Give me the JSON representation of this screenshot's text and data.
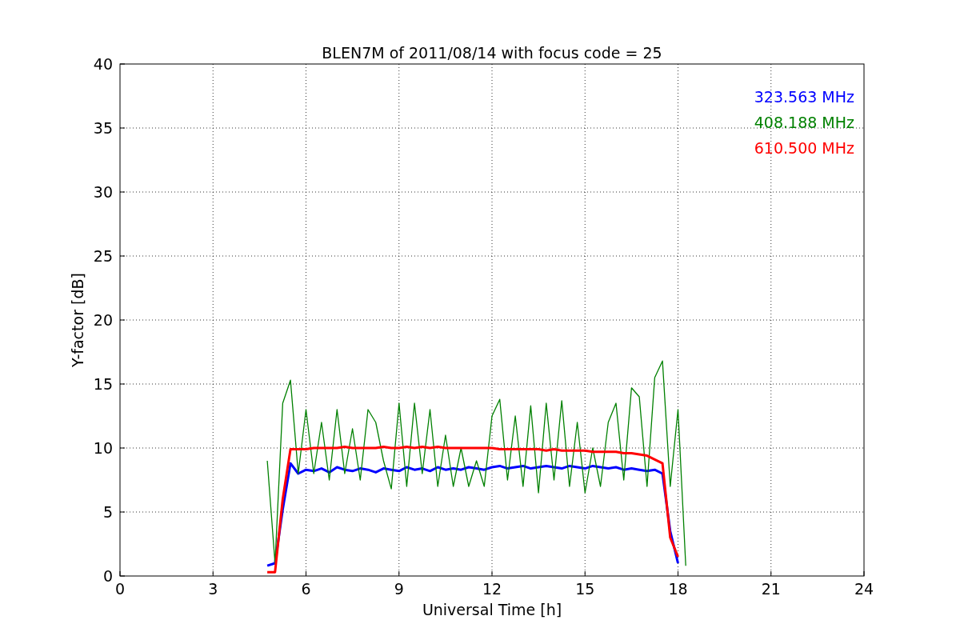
{
  "figure": {
    "chart_data": {
      "type": "line",
      "title": "BLEN7M of 2011/08/14 with focus code = 25",
      "xlabel": "Universal Time [h]",
      "ylabel": "Y-factor [dB]",
      "x": [
        4.75,
        5,
        5.25,
        5.5,
        5.75,
        6,
        6.25,
        6.5,
        6.75,
        7,
        7.25,
        7.5,
        7.75,
        8,
        8.25,
        8.5,
        8.75,
        9,
        9.25,
        9.5,
        9.75,
        10,
        10.25,
        10.5,
        10.75,
        11,
        11.25,
        11.5,
        11.75,
        12,
        12.25,
        12.5,
        12.75,
        13,
        13.25,
        13.5,
        13.75,
        14,
        14.25,
        14.5,
        14.75,
        15,
        15.25,
        15.5,
        15.75,
        16,
        16.25,
        16.5,
        16.75,
        17,
        17.25,
        17.5,
        17.75,
        18,
        18.25
      ],
      "series": [
        {
          "name": "323.563 MHz",
          "color": "#0000ff",
          "values": [
            0.8,
            1.0,
            5.2,
            8.8,
            8.0,
            8.3,
            8.2,
            8.4,
            8.1,
            8.5,
            8.3,
            8.2,
            8.4,
            8.3,
            8.1,
            8.4,
            8.3,
            8.2,
            8.5,
            8.3,
            8.4,
            8.2,
            8.5,
            8.3,
            8.4,
            8.3,
            8.5,
            8.4,
            8.3,
            8.5,
            8.6,
            8.4,
            8.5,
            8.6,
            8.4,
            8.5,
            8.6,
            8.5,
            8.4,
            8.6,
            8.5,
            8.4,
            8.6,
            8.5,
            8.4,
            8.5,
            8.3,
            8.4,
            8.3,
            8.2,
            8.3,
            8.0,
            3.5,
            1.0,
            null
          ]
        },
        {
          "name": "408.188 MHz",
          "color": "#008000",
          "values": [
            9,
            1,
            13.5,
            15.3,
            8,
            13,
            8,
            12,
            7.5,
            13,
            8,
            11.5,
            7.5,
            13,
            12,
            9,
            6.8,
            13.5,
            7,
            13.5,
            8,
            13,
            7,
            11,
            7,
            10,
            7,
            9,
            7,
            12.5,
            13.8,
            7.5,
            12.5,
            7,
            13.3,
            6.5,
            13.5,
            7.5,
            13.7,
            7,
            12,
            6.5,
            10,
            7,
            12,
            13.5,
            7.5,
            14.7,
            14,
            7,
            15.5,
            16.8,
            7,
            13,
            0.8
          ]
        },
        {
          "name": "610.500 MHz",
          "color": "#ff0000",
          "values": [
            0.3,
            0.3,
            6,
            9.9,
            9.9,
            9.9,
            10,
            10,
            10,
            10,
            10.1,
            10,
            10,
            10,
            10,
            10.1,
            10,
            10,
            10.1,
            10,
            10.1,
            10,
            10.1,
            10,
            10,
            10,
            10,
            10,
            10,
            10,
            9.9,
            9.9,
            9.9,
            9.9,
            9.9,
            9.9,
            9.8,
            9.9,
            9.8,
            9.8,
            9.8,
            9.8,
            9.7,
            9.7,
            9.7,
            9.7,
            9.6,
            9.6,
            9.5,
            9.4,
            9.1,
            8.8,
            3,
            1.5,
            null
          ]
        }
      ],
      "grid": true,
      "xlim": [
        0,
        24
      ],
      "ylim": [
        0,
        40
      ],
      "xticks": [
        0,
        3,
        6,
        9,
        12,
        15,
        18,
        21,
        24
      ],
      "yticks": [
        0,
        5,
        10,
        15,
        20,
        25,
        30,
        35,
        40
      ]
    }
  }
}
